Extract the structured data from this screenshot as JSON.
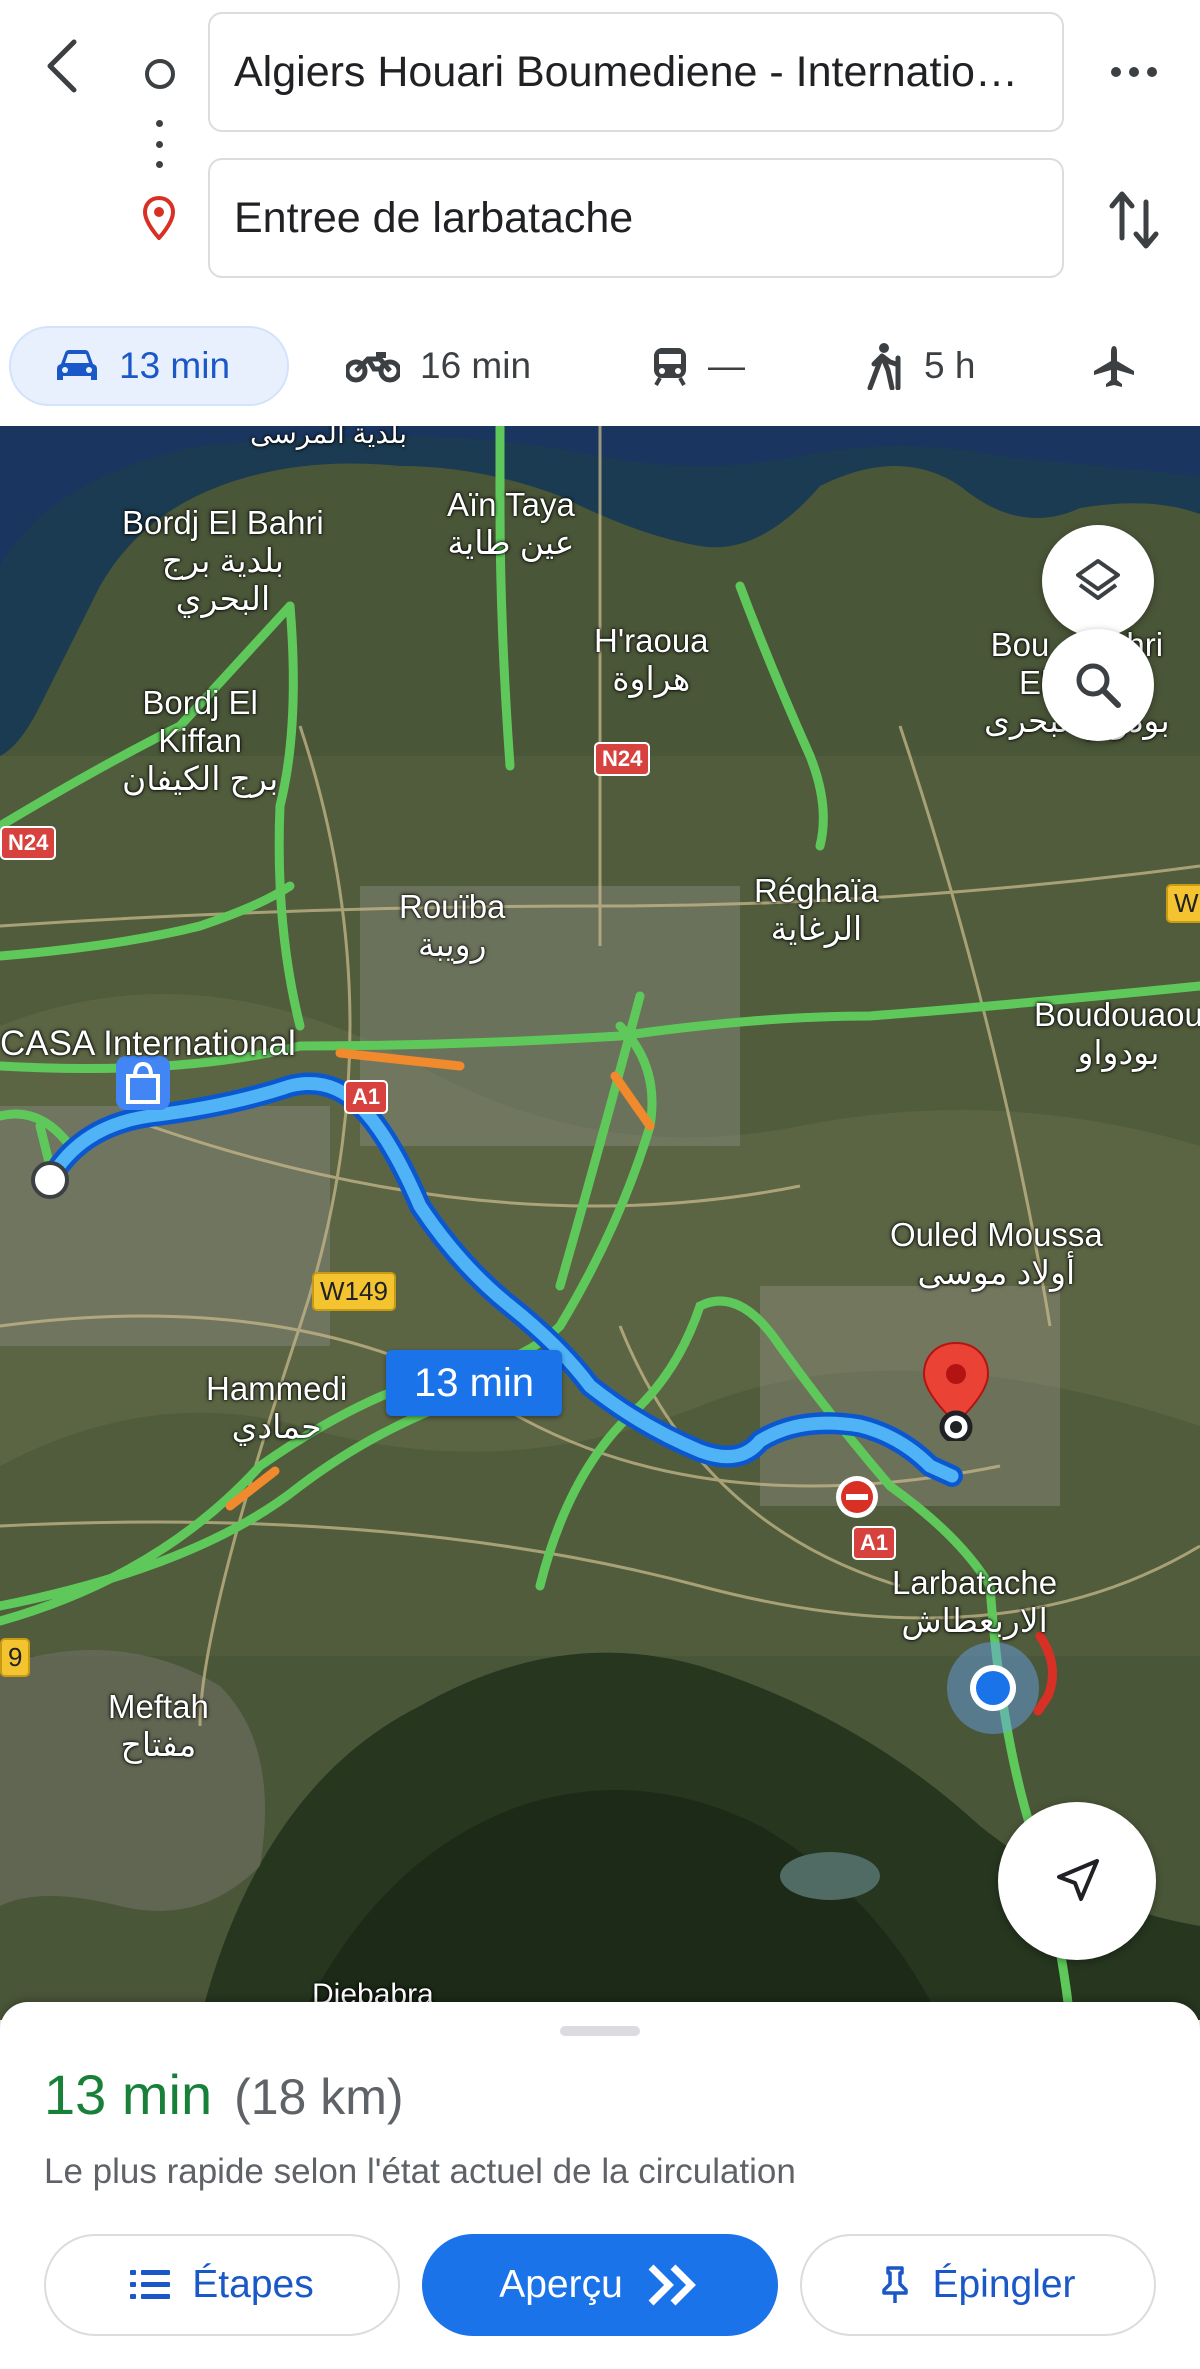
{
  "header": {
    "origin_value": "Algiers Houari Boumediene - International Airport",
    "destination_value": "Entree de larbatache",
    "icons": [
      "back-arrow-icon",
      "origin-circle-icon",
      "destination-pin-icon",
      "more-vert-icon",
      "swap-icon"
    ]
  },
  "modes": [
    {
      "name": "car",
      "label": "13 min",
      "active": true
    },
    {
      "name": "motorcycle",
      "label": "16 min"
    },
    {
      "name": "transit",
      "label": "—"
    },
    {
      "name": "walk",
      "label": "5 h"
    },
    {
      "name": "flight",
      "label": ""
    }
  ],
  "map": {
    "places": {
      "bordj_bahri": "Bordj El Bahri\nبلدية برج\nالبحري",
      "ain_taya": "Aïn Taya\nعين طاية",
      "hraoua": "H'raoua\nهراوة",
      "bordj_kiffan": "Bordj El\nKiffan\nبرج الكيفان",
      "bou_bahri": "Bou    Bahri\nEl Bahri\nبودواو البحرى",
      "rouiba": "Rouïba\nرويبة",
      "reghaia": "Réghaïa\nالرغاية",
      "casa": "CASA International",
      "boudouaou": "Boudouaou\nبودواو",
      "ouled_moussa": "Ouled Moussa\nأولاد موسى",
      "hammedi": "Hammedi\nحمادي",
      "larbatache": "Larbatache\nالاربعطاش",
      "meftah": "Meftah\nمفتاح",
      "djebabra": "Djebabra",
      "top_cut": "بلدية المرسى"
    },
    "shields": {
      "n24_a": "N24",
      "n24_b": "N24",
      "a1_a": "A1",
      "a1_b": "A1",
      "w149": "W149",
      "w_edge": "W",
      "edge_9": "9"
    },
    "route_badge": "13 min",
    "colors": {
      "route": "#1a73e8",
      "traffic_green": "#5ec95a",
      "traffic_orange": "#f08a2c",
      "traffic_red": "#d93025"
    }
  },
  "sheet": {
    "duration": "13 min",
    "distance": "(18 km)",
    "subtitle": "Le plus rapide selon l'état actuel de la circulation",
    "steps_label": "Étapes",
    "preview_label": "Aperçu",
    "pin_label": "Épingler"
  }
}
